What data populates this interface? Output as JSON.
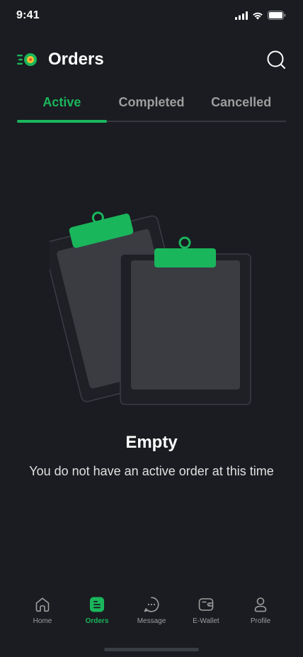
{
  "status_bar": {
    "time": "9:41",
    "icons": [
      "cellular-signal-icon",
      "wifi-icon",
      "battery-icon"
    ]
  },
  "header": {
    "title": "Orders",
    "logo_icon": "food-delivery-logo-icon",
    "search_icon": "search-icon"
  },
  "tabs": [
    {
      "label": "Active",
      "active": true
    },
    {
      "label": "Completed",
      "active": false
    },
    {
      "label": "Cancelled",
      "active": false
    }
  ],
  "empty_state": {
    "illustration": "clipboards-illustration",
    "title": "Empty",
    "description": "You do not have an active order at this time"
  },
  "bottom_nav": [
    {
      "label": "Home",
      "icon": "home-icon",
      "active": false
    },
    {
      "label": "Orders",
      "icon": "orders-icon",
      "active": true
    },
    {
      "label": "Message",
      "icon": "message-icon",
      "active": false
    },
    {
      "label": "E-Wallet",
      "icon": "wallet-icon",
      "active": false
    },
    {
      "label": "Profile",
      "icon": "profile-icon",
      "active": false
    }
  ],
  "colors": {
    "accent": "#1AB65C",
    "background": "#1A1C21",
    "inactive_text": "#9E9E9E"
  }
}
